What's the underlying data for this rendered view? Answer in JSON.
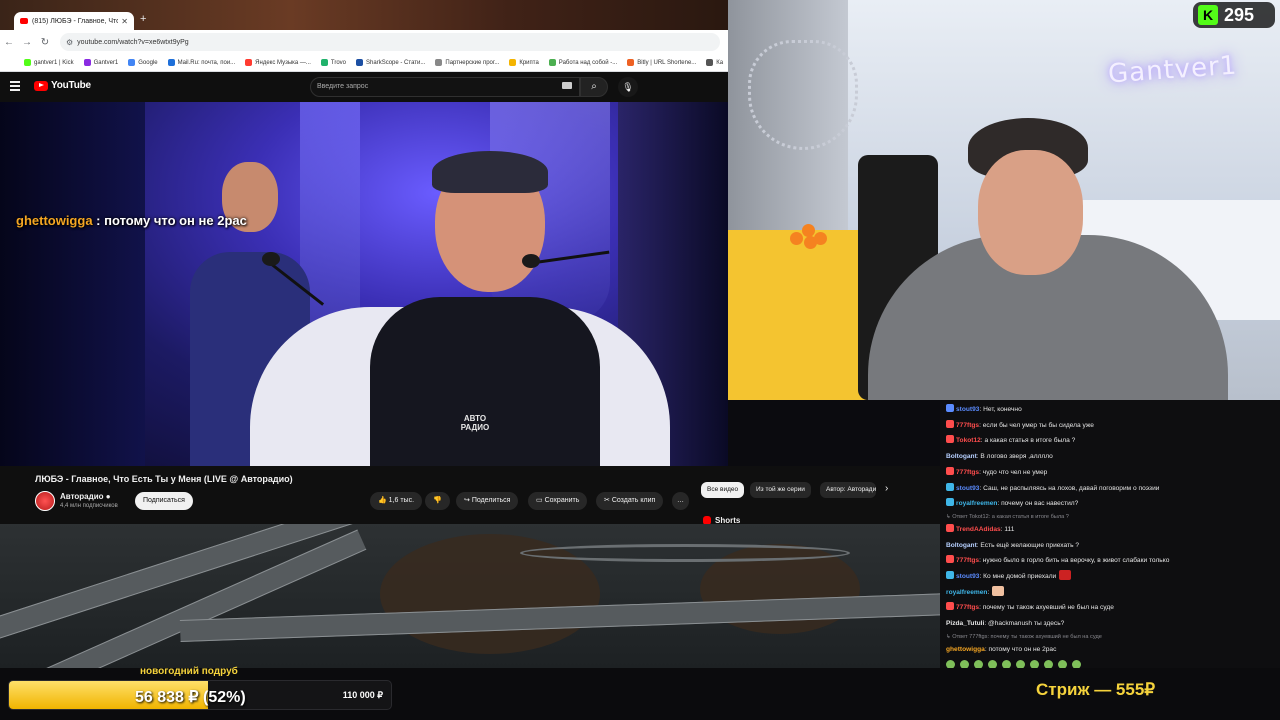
{
  "browser": {
    "tab_title": "(815) ЛЮБЭ - Главное, Что Ес",
    "url": "youtube.com/watch?v=xe6wtxt9yPg",
    "bookmarks": [
      "gantver1 | Kick",
      "Gantver1",
      "Google",
      "Mail.Ru: почта, пои...",
      "Яндекс Музыка —...",
      "Trovo",
      "SharkScope - Стати...",
      "Партнерские прог...",
      "Крипта",
      "Работа над собой -...",
      "Bitly | URL Shortene...",
      "Ка"
    ]
  },
  "youtube": {
    "logo": "YouTube",
    "search_placeholder": "Введите запрос",
    "video_title": "ЛЮБЭ - Главное, Что Есть Ты у Меня (LIVE @ Авторадио)",
    "channel_name": "Авторадио",
    "channel_subs": "4,4 млн подписчиков",
    "subscribe": "Подписаться",
    "likes": "1,6 тыс.",
    "share": "Поделиться",
    "save": "Сохранить",
    "clip": "Создать клип",
    "more": "…",
    "chips": [
      "Все видео",
      "Из той же серии",
      "Автор: Авторади"
    ],
    "shorts": "Shorts",
    "vest_logo_line1": "АВТО",
    "vest_logo_line2": "РАДИО"
  },
  "overlay": {
    "nick": "ghettowigga",
    "text": " : потому что он не 2рас"
  },
  "webcam": {
    "neon_sign": "Gantver1",
    "viewer_count": "295"
  },
  "chat": {
    "messages": [
      {
        "nick": "stout93",
        "text": ": Нет, конечно",
        "color": "#5b8cff",
        "badge": "#5b8cff"
      },
      {
        "nick": "777ftgs",
        "text": ": если бы чел умер ты бы сидела уже",
        "color": "#ff4d4d",
        "badge": "#ff4d4d"
      },
      {
        "nick": "Tokot12",
        "text": ": а какая статья в итоге была ?",
        "color": "#ff4d4d",
        "badge": "#ff4d4d"
      },
      {
        "nick": "Boltogant",
        "text": ": В логово зверя ,аллллo",
        "color": "#b7d0ff",
        "badge": ""
      },
      {
        "nick": "777ftgs",
        "text": ": чудо что чел не умер",
        "color": "#ff4d4d",
        "badge": "#ff4d4d"
      },
      {
        "nick": "stout93",
        "text": ": Саш, не распыляясь на лохов, давай поговорим о поэзии",
        "color": "#5b8cff",
        "badge": "#3fb6e8"
      },
      {
        "nick": "royalfreemen",
        "text": ": почему он вас навестил?",
        "color": "#3fb6e8",
        "badge": "#3fb6e8"
      }
    ],
    "reply1": "↳ Ответ Tokot12: а какая статья в итоге была ?",
    "messages2": [
      {
        "nick": "TrendAAdidas",
        "text": ": 111",
        "color": "#ff4d4d",
        "badge": "#ff4d4d"
      },
      {
        "nick": "Boltogant",
        "text": ": Есть ещё желающие приехать ?",
        "color": "#b7d0ff",
        "badge": ""
      },
      {
        "nick": "777ftgs",
        "text": ": нужно было в горло бить на верочку, в живот слабаки только",
        "color": "#ff4d4d",
        "badge": "#ff4d4d"
      },
      {
        "nick": "stout93",
        "text": ": Ко мне домой приехали",
        "color": "#5b8cff",
        "badge": "#3fb6e8",
        "emote": "#cc2222"
      },
      {
        "nick": "royalfreemen",
        "text": ":",
        "color": "#3fb6e8",
        "badge": "",
        "emote": "#f0c0a0"
      },
      {
        "nick": "777ftgs",
        "text": ": почему ты також ахуевший не был на суде",
        "color": "#ff4d4d",
        "badge": "#ff4d4d"
      },
      {
        "nick": "Pizda_Tutuli",
        "text": ": @hackmanush ты здесь?",
        "color": "#e6e6e6",
        "badge": ""
      }
    ],
    "reply2": "↳ Ответ 777ftgs: почему ты також ахуевший не был на суде",
    "last": {
      "nick": "ghettowigga",
      "text": ": потому что он не 2рас",
      "color": "#f5a623"
    }
  },
  "goal": {
    "title": "новогодний подруб",
    "current": "56 838 ₽ (52%)",
    "target": "110 000 ₽",
    "progress": 0.52
  },
  "ticker": {
    "text": "Стриж — 555₽"
  }
}
